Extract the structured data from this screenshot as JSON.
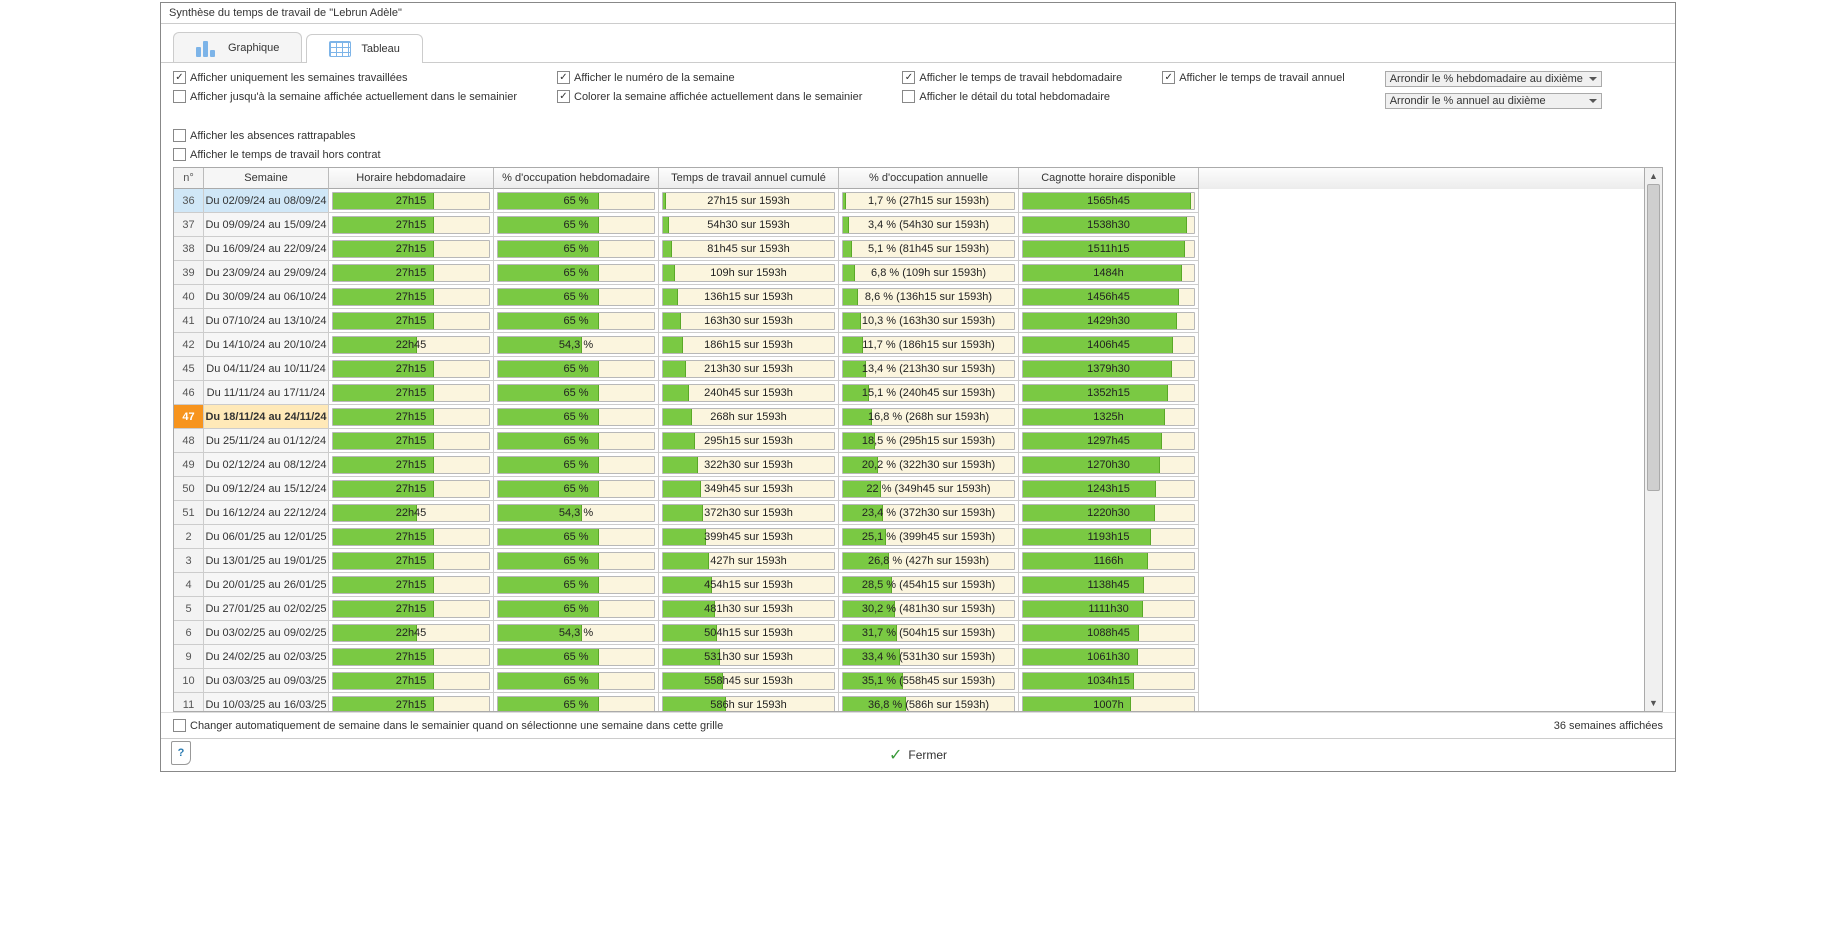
{
  "title": "Synthèse du temps de travail de \"Lebrun Adèle\"",
  "tabs": {
    "graph": "Graphique",
    "table": "Tableau",
    "active": "table"
  },
  "checks": {
    "only_worked": {
      "label": "Afficher uniquement les semaines travaillées",
      "checked": true
    },
    "until_current": {
      "label": "Afficher jusqu'à la semaine affichée actuellement dans le semainier",
      "checked": false
    },
    "show_week_num": {
      "label": "Afficher le numéro de la semaine",
      "checked": true
    },
    "color_current": {
      "label": "Colorer la semaine affichée actuellement dans le semainier",
      "checked": true
    },
    "show_weekly_time": {
      "label": "Afficher le temps de travail hebdomadaire",
      "checked": true
    },
    "show_weekly_detail": {
      "label": "Afficher le détail du total hebdomadaire",
      "checked": false
    },
    "show_annual_time": {
      "label": "Afficher le temps de travail annuel",
      "checked": true
    },
    "show_absences": {
      "label": "Afficher les absences rattrapables",
      "checked": false
    },
    "show_off_contract": {
      "label": "Afficher le temps de travail hors contrat",
      "checked": false
    },
    "auto_change": {
      "label": "Changer automatiquement de semaine dans le semainier quand on sélectionne une semaine dans cette grille",
      "checked": false
    }
  },
  "selects": {
    "round_week": "Arrondir le % hebdomadaire au dixième",
    "round_year": "Arrondir le % annuel au dixième"
  },
  "headers": {
    "num": "n°",
    "week": "Semaine",
    "hours": "Horaire hebdomadaire",
    "occ": "% d'occupation hebdomadaire",
    "cum": "Temps de travail annuel cumulé",
    "ann": "% d'occupation annuelle",
    "cag": "Cagnotte horaire disponible"
  },
  "rows": [
    {
      "num": "36",
      "week": "Du 02/09/24 au 08/09/24",
      "hours": "27h15",
      "hp": 65,
      "occ": "65 %",
      "op": 65,
      "cum": "27h15 sur 1593h",
      "cp": 1.7,
      "ann": "1,7 % (27h15 sur 1593h)",
      "ap": 1.7,
      "cag": "1565h45",
      "gp": 98,
      "sel": true
    },
    {
      "num": "37",
      "week": "Du 09/09/24 au 15/09/24",
      "hours": "27h15",
      "hp": 65,
      "occ": "65 %",
      "op": 65,
      "cum": "54h30 sur 1593h",
      "cp": 3.4,
      "ann": "3,4 % (54h30 sur 1593h)",
      "ap": 3.4,
      "cag": "1538h30",
      "gp": 96
    },
    {
      "num": "38",
      "week": "Du 16/09/24 au 22/09/24",
      "hours": "27h15",
      "hp": 65,
      "occ": "65 %",
      "op": 65,
      "cum": "81h45 sur 1593h",
      "cp": 5.1,
      "ann": "5,1 % (81h45 sur 1593h)",
      "ap": 5.1,
      "cag": "1511h15",
      "gp": 95
    },
    {
      "num": "39",
      "week": "Du 23/09/24 au 29/09/24",
      "hours": "27h15",
      "hp": 65,
      "occ": "65 %",
      "op": 65,
      "cum": "109h sur 1593h",
      "cp": 6.8,
      "ann": "6,8 % (109h sur 1593h)",
      "ap": 6.8,
      "cag": "1484h",
      "gp": 93
    },
    {
      "num": "40",
      "week": "Du 30/09/24 au 06/10/24",
      "hours": "27h15",
      "hp": 65,
      "occ": "65 %",
      "op": 65,
      "cum": "136h15 sur 1593h",
      "cp": 8.6,
      "ann": "8,6 % (136h15 sur 1593h)",
      "ap": 8.6,
      "cag": "1456h45",
      "gp": 91
    },
    {
      "num": "41",
      "week": "Du 07/10/24 au 13/10/24",
      "hours": "27h15",
      "hp": 65,
      "occ": "65 %",
      "op": 65,
      "cum": "163h30 sur 1593h",
      "cp": 10.3,
      "ann": "10,3 % (163h30 sur 1593h)",
      "ap": 10.3,
      "cag": "1429h30",
      "gp": 90
    },
    {
      "num": "42",
      "week": "Du 14/10/24 au 20/10/24",
      "hours": "22h45",
      "hp": 54,
      "occ": "54,3 %",
      "op": 54,
      "cum": "186h15 sur 1593h",
      "cp": 11.7,
      "ann": "11,7 % (186h15 sur 1593h)",
      "ap": 11.7,
      "cag": "1406h45",
      "gp": 88
    },
    {
      "num": "45",
      "week": "Du 04/11/24 au 10/11/24",
      "hours": "27h15",
      "hp": 65,
      "occ": "65 %",
      "op": 65,
      "cum": "213h30 sur 1593h",
      "cp": 13.4,
      "ann": "13,4 % (213h30 sur 1593h)",
      "ap": 13.4,
      "cag": "1379h30",
      "gp": 87
    },
    {
      "num": "46",
      "week": "Du 11/11/24 au 17/11/24",
      "hours": "27h15",
      "hp": 65,
      "occ": "65 %",
      "op": 65,
      "cum": "240h45 sur 1593h",
      "cp": 15.1,
      "ann": "15,1 % (240h45 sur 1593h)",
      "ap": 15.1,
      "cag": "1352h15",
      "gp": 85
    },
    {
      "num": "47",
      "week": "Du 18/11/24 au 24/11/24",
      "hours": "27h15",
      "hp": 65,
      "occ": "65 %",
      "op": 65,
      "cum": "268h sur 1593h",
      "cp": 16.8,
      "ann": "16,8 % (268h sur 1593h)",
      "ap": 16.8,
      "cag": "1325h",
      "gp": 83,
      "hil": true
    },
    {
      "num": "48",
      "week": "Du 25/11/24 au 01/12/24",
      "hours": "27h15",
      "hp": 65,
      "occ": "65 %",
      "op": 65,
      "cum": "295h15 sur 1593h",
      "cp": 18.5,
      "ann": "18,5 % (295h15 sur 1593h)",
      "ap": 18.5,
      "cag": "1297h45",
      "gp": 81
    },
    {
      "num": "49",
      "week": "Du 02/12/24 au 08/12/24",
      "hours": "27h15",
      "hp": 65,
      "occ": "65 %",
      "op": 65,
      "cum": "322h30 sur 1593h",
      "cp": 20.2,
      "ann": "20,2 % (322h30 sur 1593h)",
      "ap": 20.2,
      "cag": "1270h30",
      "gp": 80
    },
    {
      "num": "50",
      "week": "Du 09/12/24 au 15/12/24",
      "hours": "27h15",
      "hp": 65,
      "occ": "65 %",
      "op": 65,
      "cum": "349h45 sur 1593h",
      "cp": 22,
      "ann": "22 % (349h45 sur 1593h)",
      "ap": 22,
      "cag": "1243h15",
      "gp": 78
    },
    {
      "num": "51",
      "week": "Du 16/12/24 au 22/12/24",
      "hours": "22h45",
      "hp": 54,
      "occ": "54,3 %",
      "op": 54,
      "cum": "372h30 sur 1593h",
      "cp": 23.4,
      "ann": "23,4 % (372h30 sur 1593h)",
      "ap": 23.4,
      "cag": "1220h30",
      "gp": 77
    },
    {
      "num": "2",
      "week": "Du 06/01/25 au 12/01/25",
      "hours": "27h15",
      "hp": 65,
      "occ": "65 %",
      "op": 65,
      "cum": "399h45 sur 1593h",
      "cp": 25.1,
      "ann": "25,1 % (399h45 sur 1593h)",
      "ap": 25.1,
      "cag": "1193h15",
      "gp": 75
    },
    {
      "num": "3",
      "week": "Du 13/01/25 au 19/01/25",
      "hours": "27h15",
      "hp": 65,
      "occ": "65 %",
      "op": 65,
      "cum": "427h sur 1593h",
      "cp": 26.8,
      "ann": "26,8 % (427h sur 1593h)",
      "ap": 26.8,
      "cag": "1166h",
      "gp": 73
    },
    {
      "num": "4",
      "week": "Du 20/01/25 au 26/01/25",
      "hours": "27h15",
      "hp": 65,
      "occ": "65 %",
      "op": 65,
      "cum": "454h15 sur 1593h",
      "cp": 28.5,
      "ann": "28,5 % (454h15 sur 1593h)",
      "ap": 28.5,
      "cag": "1138h45",
      "gp": 71
    },
    {
      "num": "5",
      "week": "Du 27/01/25 au 02/02/25",
      "hours": "27h15",
      "hp": 65,
      "occ": "65 %",
      "op": 65,
      "cum": "481h30 sur 1593h",
      "cp": 30.2,
      "ann": "30,2 % (481h30 sur 1593h)",
      "ap": 30.2,
      "cag": "1111h30",
      "gp": 70
    },
    {
      "num": "6",
      "week": "Du 03/02/25 au 09/02/25",
      "hours": "22h45",
      "hp": 54,
      "occ": "54,3 %",
      "op": 54,
      "cum": "504h15 sur 1593h",
      "cp": 31.7,
      "ann": "31,7 % (504h15 sur 1593h)",
      "ap": 31.7,
      "cag": "1088h45",
      "gp": 68
    },
    {
      "num": "9",
      "week": "Du 24/02/25 au 02/03/25",
      "hours": "27h15",
      "hp": 65,
      "occ": "65 %",
      "op": 65,
      "cum": "531h30 sur 1593h",
      "cp": 33.4,
      "ann": "33,4 % (531h30 sur 1593h)",
      "ap": 33.4,
      "cag": "1061h30",
      "gp": 67
    },
    {
      "num": "10",
      "week": "Du 03/03/25 au 09/03/25",
      "hours": "27h15",
      "hp": 65,
      "occ": "65 %",
      "op": 65,
      "cum": "558h45 sur 1593h",
      "cp": 35.1,
      "ann": "35,1 % (558h45 sur 1593h)",
      "ap": 35.1,
      "cag": "1034h15",
      "gp": 65
    },
    {
      "num": "11",
      "week": "Du 10/03/25 au 16/03/25",
      "hours": "27h15",
      "hp": 65,
      "occ": "65 %",
      "op": 65,
      "cum": "586h sur 1593h",
      "cp": 36.8,
      "ann": "36,8 % (586h sur 1593h)",
      "ap": 36.8,
      "cag": "1007h",
      "gp": 63
    }
  ],
  "status": "36 semaines affichées",
  "close": "Fermer"
}
